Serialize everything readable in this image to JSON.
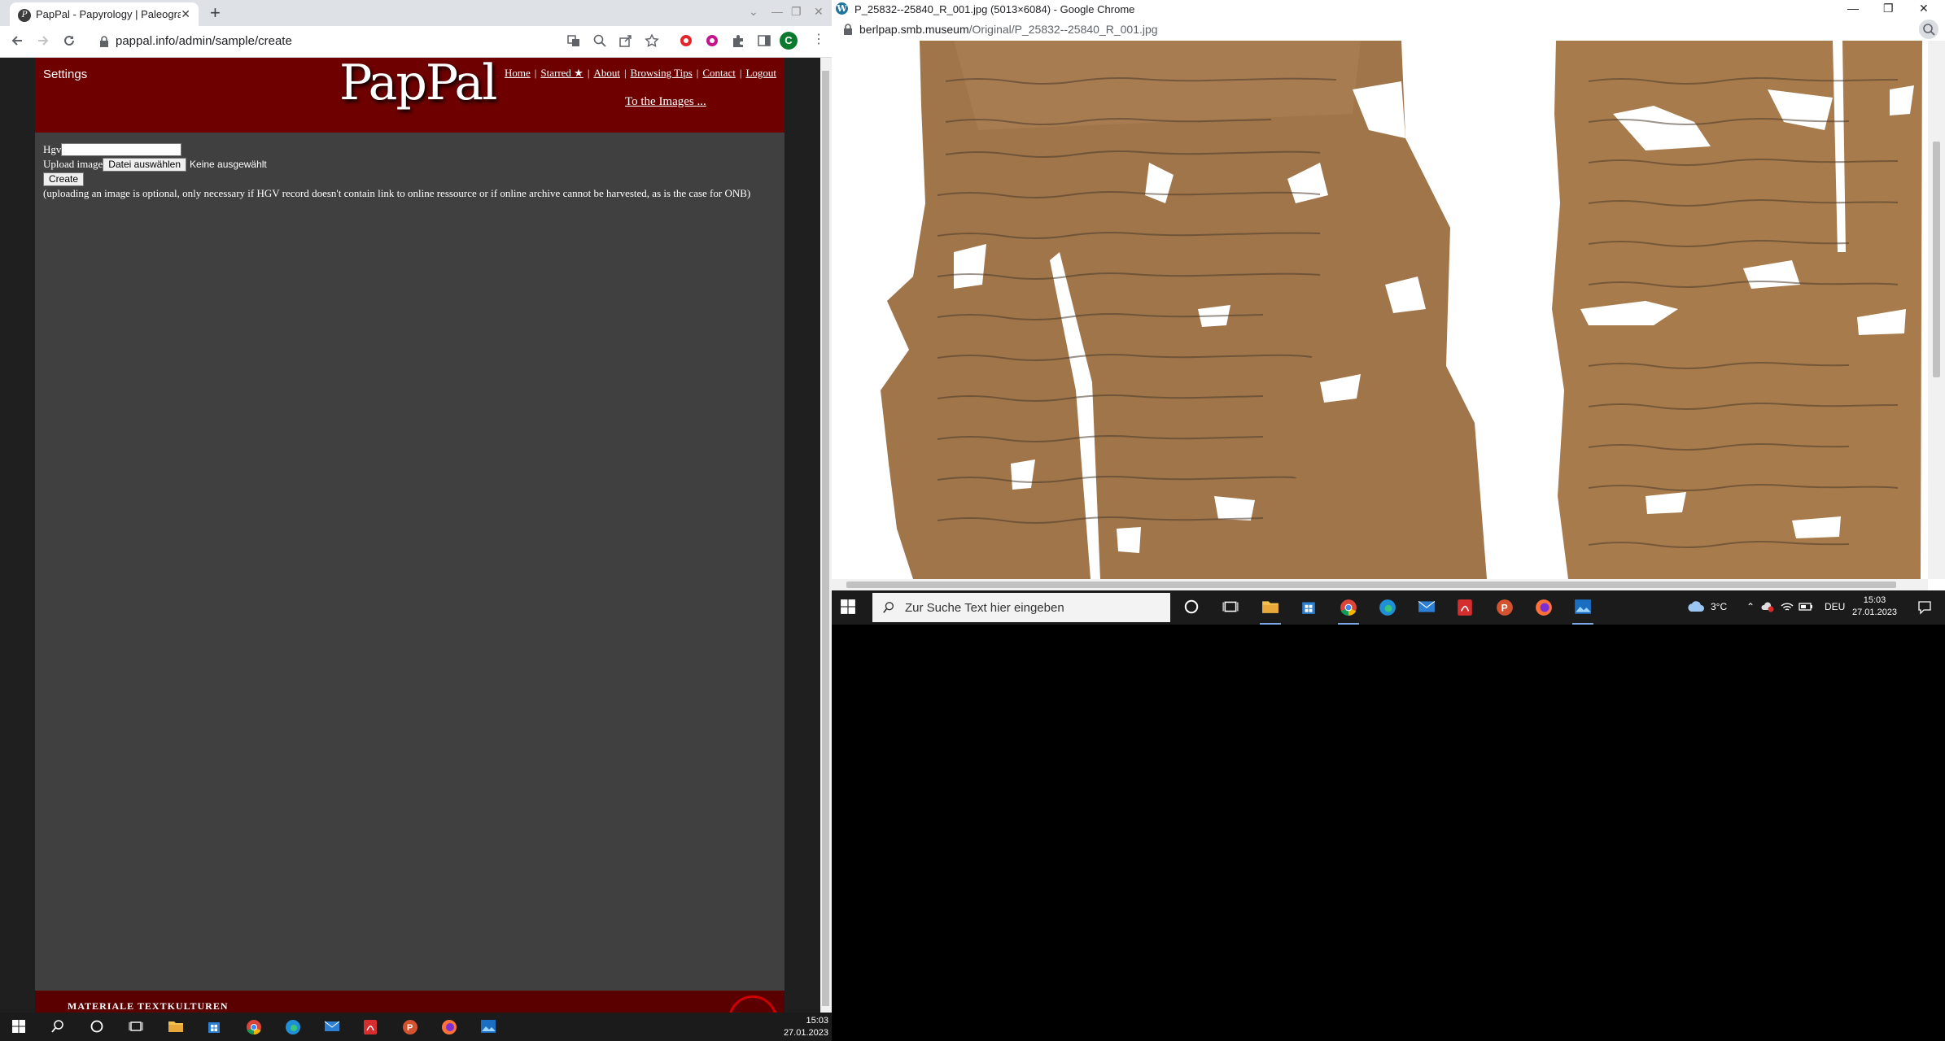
{
  "left_window": {
    "tab_title": "PapPal - Papyrology | Paleograph",
    "url": "pappal.info/admin/sample/create",
    "avatar_letter": "C",
    "page": {
      "settings": "Settings",
      "logo": "PapPal",
      "nav": [
        "Home",
        "Starred ★",
        "About",
        "Browsing Tips",
        "Contact",
        "Logout"
      ],
      "to_images": "To the Images ...",
      "form": {
        "hgv_label": "Hgv",
        "hgv_value": "",
        "upload_label": "Upload image",
        "file_button": "Datei auswählen",
        "file_status": "Keine ausgewählt",
        "create_button": "Create",
        "note": "(uploading an image is optional, only necessary if HGV record doesn't contain link to online ressource or if online archive cannot be harvested, as is the case for ONB)"
      },
      "footer_text": "MATERIALE TEXTKULTUREN"
    },
    "taskbar": {
      "time": "15:03",
      "date": "27.01.2023"
    }
  },
  "right_window": {
    "title": "P_25832--25840_R_001.jpg (5013×6084) - Google Chrome",
    "url_host": "berlpap.smb.museum",
    "url_path": "/Original/P_25832--25840_R_001.jpg",
    "taskbar": {
      "search_placeholder": "Zur Suche Text hier eingeben",
      "weather": "3°C",
      "language": "DEU",
      "time": "15:03",
      "date": "27.01.2023"
    }
  },
  "colors": {
    "header_red": "#6e0000",
    "page_gray": "#404040",
    "papyrus": "#a0754a"
  }
}
